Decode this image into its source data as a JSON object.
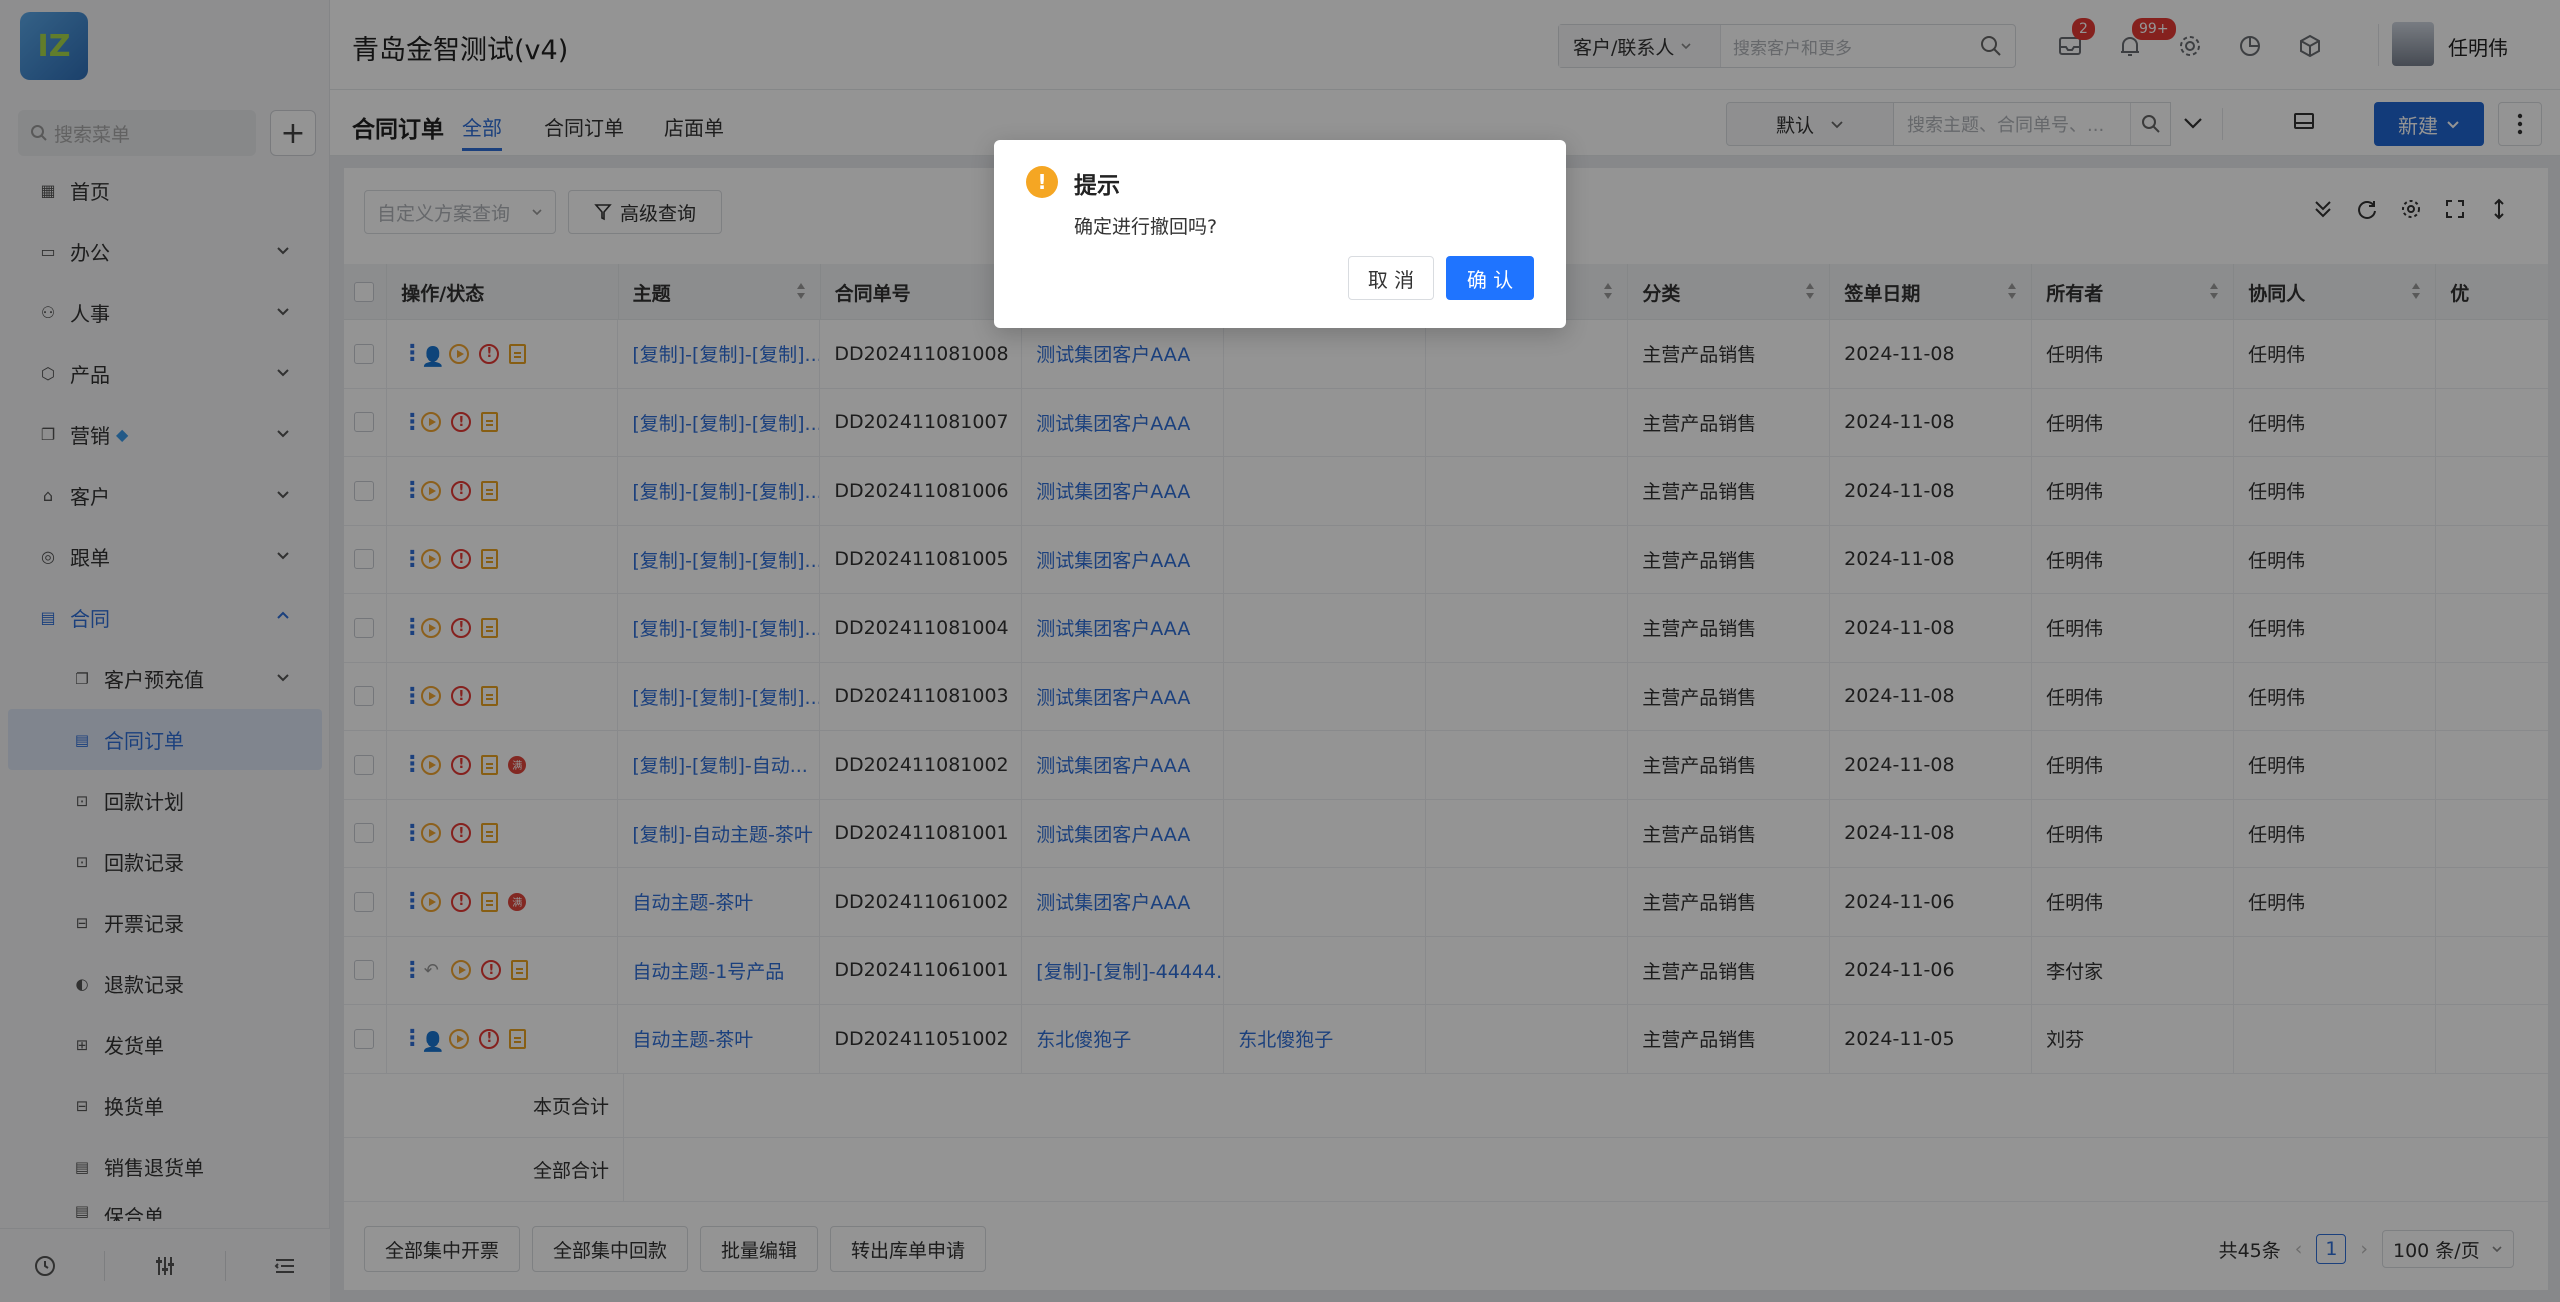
{
  "app": {
    "title": "青岛金智测试(v4)",
    "logo_text": "IZ"
  },
  "header": {
    "search_type": "客户/联系人",
    "search_placeholder": "搜索客户和更多",
    "badges": {
      "messages": "2",
      "notifications": "99+"
    },
    "user_name": "任明伟"
  },
  "sidebar": {
    "search_placeholder": "搜索菜单",
    "items": [
      {
        "label": "首页",
        "icon": "home-icon"
      },
      {
        "label": "办公",
        "icon": "office-icon"
      },
      {
        "label": "人事",
        "icon": "people-icon"
      },
      {
        "label": "产品",
        "icon": "box-icon"
      },
      {
        "label": "营销",
        "icon": "marketing-icon"
      },
      {
        "label": "客户",
        "icon": "customer-icon"
      },
      {
        "label": "跟单",
        "icon": "followup-icon"
      },
      {
        "label": "合同",
        "icon": "contract-icon"
      }
    ],
    "sub_items": [
      {
        "label": "客户预充值"
      },
      {
        "label": "合同订单"
      },
      {
        "label": "回款计划"
      },
      {
        "label": "回款记录"
      },
      {
        "label": "开票记录"
      },
      {
        "label": "退款记录"
      },
      {
        "label": "发货单"
      },
      {
        "label": "换货单"
      },
      {
        "label": "销售退货单"
      },
      {
        "label": "保合单"
      }
    ]
  },
  "subbar": {
    "page_title": "合同订单",
    "tabs": [
      "全部",
      "合同订单",
      "店面单"
    ],
    "view": "默认",
    "search_placeholder": "搜索主题、合同单号、...",
    "new_label": "新建"
  },
  "filters": {
    "plan_placeholder": "自定义方案查询",
    "advanced_label": "高级查询"
  },
  "table": {
    "columns": [
      "操作/状态",
      "主题",
      "合同单号",
      "",
      "",
      "",
      "分类",
      "签单日期",
      "所有者",
      "协同人",
      "优"
    ],
    "rows": [
      {
        "subject": "[复制]-[复制]-[复制]...",
        "no": "DD202411081008",
        "customer": "测试集团客户AAA",
        "contact": "",
        "category": "主营产品销售",
        "date": "2024-11-08",
        "owner": "任明伟",
        "collab": "任明伟"
      },
      {
        "subject": "[复制]-[复制]-[复制]...",
        "no": "DD202411081007",
        "customer": "测试集团客户AAA",
        "contact": "",
        "category": "主营产品销售",
        "date": "2024-11-08",
        "owner": "任明伟",
        "collab": "任明伟"
      },
      {
        "subject": "[复制]-[复制]-[复制]...",
        "no": "DD202411081006",
        "customer": "测试集团客户AAA",
        "contact": "",
        "category": "主营产品销售",
        "date": "2024-11-08",
        "owner": "任明伟",
        "collab": "任明伟"
      },
      {
        "subject": "[复制]-[复制]-[复制]...",
        "no": "DD202411081005",
        "customer": "测试集团客户AAA",
        "contact": "",
        "category": "主营产品销售",
        "date": "2024-11-08",
        "owner": "任明伟",
        "collab": "任明伟"
      },
      {
        "subject": "[复制]-[复制]-[复制]...",
        "no": "DD202411081004",
        "customer": "测试集团客户AAA",
        "contact": "",
        "category": "主营产品销售",
        "date": "2024-11-08",
        "owner": "任明伟",
        "collab": "任明伟"
      },
      {
        "subject": "[复制]-[复制]-[复制]...",
        "no": "DD202411081003",
        "customer": "测试集团客户AAA",
        "contact": "",
        "category": "主营产品销售",
        "date": "2024-11-08",
        "owner": "任明伟",
        "collab": "任明伟"
      },
      {
        "subject": "[复制]-[复制]-自动...",
        "no": "DD202411081002",
        "customer": "测试集团客户AAA",
        "contact": "",
        "category": "主营产品销售",
        "date": "2024-11-08",
        "owner": "任明伟",
        "collab": "任明伟"
      },
      {
        "subject": "[复制]-自动主题-茶叶",
        "no": "DD202411081001",
        "customer": "测试集团客户AAA",
        "contact": "",
        "category": "主营产品销售",
        "date": "2024-11-08",
        "owner": "任明伟",
        "collab": "任明伟"
      },
      {
        "subject": "自动主题-茶叶",
        "no": "DD202411061002",
        "customer": "测试集团客户AAA",
        "contact": "",
        "category": "主营产品销售",
        "date": "2024-11-06",
        "owner": "任明伟",
        "collab": "任明伟"
      },
      {
        "subject": "自动主题-1号产品",
        "no": "DD202411061001",
        "customer": "[复制]-[复制]-44444...",
        "contact": "",
        "category": "主营产品销售",
        "date": "2024-11-06",
        "owner": "李付家",
        "collab": ""
      },
      {
        "subject": "自动主题-茶叶",
        "no": "DD202411051002",
        "customer": "东北傻狍子",
        "contact": "东北傻狍子",
        "category": "主营产品销售",
        "date": "2024-11-05",
        "owner": "刘芬",
        "collab": ""
      }
    ],
    "page_sum_label": "本页合计",
    "total_sum_label": "全部合计"
  },
  "bottom": {
    "buttons": [
      "全部集中开票",
      "全部集中回款",
      "批量编辑",
      "转出库单申请"
    ],
    "total": "共45条",
    "page": "1",
    "page_size": "100 条/页"
  },
  "dialog": {
    "title": "提示",
    "message": "确定进行撤回吗?",
    "cancel_label": "取 消",
    "ok_label": "确 认",
    "icon": "warning-icon"
  },
  "colors": {
    "primary": "#2066d3",
    "link": "#2f6fd8",
    "warning": "#f5a623",
    "danger": "#e53935"
  }
}
